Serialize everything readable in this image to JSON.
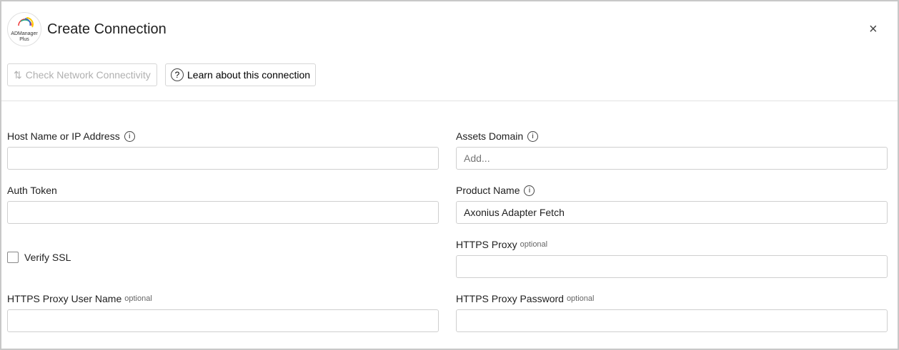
{
  "header": {
    "title": "Create Connection",
    "logo_text": "ADManager Plus",
    "close": "×"
  },
  "toolbar": {
    "check": "Check Network Connectivity",
    "learn": "Learn about this connection"
  },
  "fields": {
    "host": {
      "label": "Host Name or IP Address",
      "value": ""
    },
    "assets": {
      "label": "Assets Domain",
      "placeholder": "Add..."
    },
    "token": {
      "label": "Auth Token",
      "value": ""
    },
    "product": {
      "label": "Product Name",
      "value": "Axonius Adapter Fetch"
    },
    "ssl": {
      "label": "Verify SSL",
      "checked": false
    },
    "proxy": {
      "label": "HTTPS Proxy",
      "optional": "optional"
    },
    "proxy_user": {
      "label": "HTTPS Proxy User Name",
      "optional": "optional"
    },
    "proxy_pass": {
      "label": "HTTPS Proxy Password",
      "optional": "optional"
    }
  }
}
